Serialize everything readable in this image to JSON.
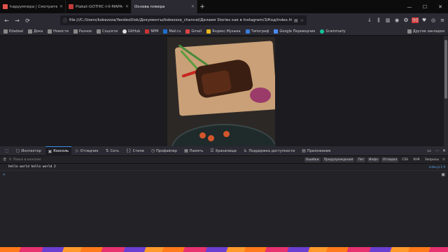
{
  "tabs": [
    {
      "label": "happyмпера | Смотрите анимe",
      "color": "#e0524a"
    },
    {
      "label": "Plakat-GOTHIC-I-II-MAPA-Poster",
      "color": "#c23b3b"
    },
    {
      "label": "Основа плеера",
      "color": "#8a8a8a"
    }
  ],
  "url": "file:///C:/Users/kobezzza/YandexDisk/Документы/kobezzza_channel/Делаем Stories как в Instagram/3/Код/index.html",
  "bookmarks": [
    "Edadeal",
    "Дока",
    "Новости",
    "Разное",
    "Соцсети",
    "GitHub",
    "NPM",
    "Mail.ru",
    "Gmail",
    "Яндекс.Музыка",
    "Типограф",
    "Google Переводчик",
    "Grammarly"
  ],
  "other_bookmarks": "Другие закладки",
  "extension_badge": "90",
  "devtools": {
    "tabs": [
      "Инспектор",
      "Консоль",
      "Отладчик",
      "Сеть",
      "Стили",
      "Профайлер",
      "Память",
      "Хранилище",
      "Поддержка доступности",
      "Приложение"
    ],
    "active_tab": "Консоль",
    "filter_placeholder": "Поиск в консоли",
    "levels": [
      "Ошибки",
      "Предупреждения",
      "Лог",
      "Инфо",
      "Отладка"
    ],
    "extra_filters": [
      "CSS",
      "XHR",
      "Запросы"
    ],
    "console_line": "hello world hello world 2",
    "console_source": "index.js:1:9",
    "prompt": "»"
  }
}
